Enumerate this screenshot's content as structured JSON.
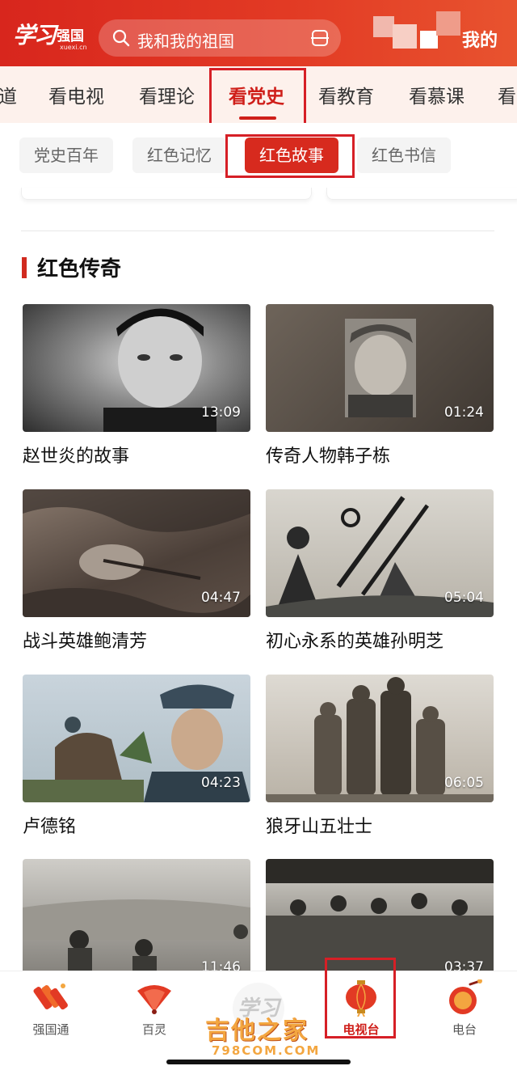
{
  "header": {
    "logo_script": "学习",
    "logo_brand": "强国",
    "logo_domain": "xuexi.cn",
    "search_placeholder": "我和我的祖国",
    "mine_label": "我的"
  },
  "channel_tabs": [
    {
      "label": "道"
    },
    {
      "label": "看电视"
    },
    {
      "label": "看理论"
    },
    {
      "label": "看党史",
      "active": true
    },
    {
      "label": "看教育"
    },
    {
      "label": "看慕课"
    },
    {
      "label": "看"
    }
  ],
  "sub_tabs": [
    {
      "label": "党史百年"
    },
    {
      "label": "红色记忆"
    },
    {
      "label": "红色故事",
      "active": true
    },
    {
      "label": "红色书信"
    }
  ],
  "section": {
    "title": "红色传奇"
  },
  "videos": [
    {
      "title": "赵世炎的故事",
      "duration": "13:09"
    },
    {
      "title": "传奇人物韩子栋",
      "duration": "01:24"
    },
    {
      "title": "战斗英雄鲍清芳",
      "duration": "04:47"
    },
    {
      "title": "初心永系的英雄孙明芝",
      "duration": "05:04"
    },
    {
      "title": "卢德铭",
      "duration": "04:23"
    },
    {
      "title": "狼牙山五壮士",
      "duration": "06:05"
    },
    {
      "title": "",
      "duration": "11:46"
    },
    {
      "title": "",
      "duration": "03:37"
    }
  ],
  "bottom_nav": [
    {
      "label": "强国通",
      "icon": "firecracker-icon"
    },
    {
      "label": "百灵",
      "icon": "fan-icon"
    },
    {
      "label": "电视台",
      "icon": "lantern-icon",
      "active": true
    },
    {
      "label": "电台",
      "icon": "drum-icon"
    }
  ],
  "center_logo": "学习",
  "watermark": {
    "text": "吉他之家",
    "domain": "798COM.COM"
  },
  "colors": {
    "brand_red": "#cf1f1a",
    "header_red": "#d8261d",
    "highlight_box": "#d61f26"
  }
}
